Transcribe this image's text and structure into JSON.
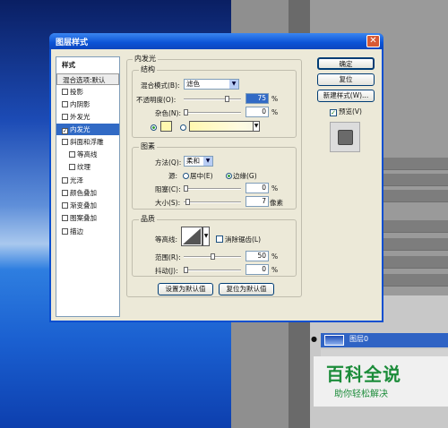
{
  "dialog": {
    "title": "图层样式",
    "close": "✕"
  },
  "style_list": {
    "header": "样式",
    "items": [
      {
        "label": "混合选项:默认",
        "checkbox": false,
        "header": true
      },
      {
        "label": "投影",
        "checkbox": true,
        "checked": false
      },
      {
        "label": "内阴影",
        "checkbox": true,
        "checked": false
      },
      {
        "label": "外发光",
        "checkbox": true,
        "checked": false
      },
      {
        "label": "内发光",
        "checkbox": true,
        "checked": true,
        "selected": true
      },
      {
        "label": "斜面和浮雕",
        "checkbox": true,
        "checked": false
      },
      {
        "label": "等高线",
        "checkbox": true,
        "checked": false,
        "indent": true
      },
      {
        "label": "纹理",
        "checkbox": true,
        "checked": false,
        "indent": true
      },
      {
        "label": "光泽",
        "checkbox": true,
        "checked": false
      },
      {
        "label": "颜色叠加",
        "checkbox": true,
        "checked": false
      },
      {
        "label": "渐变叠加",
        "checkbox": true,
        "checked": false
      },
      {
        "label": "图案叠加",
        "checkbox": true,
        "checked": false
      },
      {
        "label": "描边",
        "checkbox": true,
        "checked": false
      }
    ]
  },
  "inner_glow": {
    "section_title": "内发光",
    "structure": {
      "title": "结构",
      "blend_mode_label": "混合模式(B):",
      "blend_mode_value": "滤色",
      "opacity_label": "不透明度(O):",
      "opacity_value": "75",
      "noise_label": "杂色(N):",
      "noise_value": "0",
      "unit": "%"
    },
    "elements": {
      "title": "图素",
      "method_label": "方法(Q):",
      "method_value": "柔和",
      "source_label": "源:",
      "center_label": "居中(E)",
      "edge_label": "边缘(G)",
      "choke_label": "阻塞(C):",
      "choke_value": "0",
      "size_label": "大小(S):",
      "size_value": "7",
      "size_unit": "像素",
      "unit": "%"
    },
    "quality": {
      "title": "品质",
      "contour_label": "等高线:",
      "antialias_label": "消除锯齿(L)",
      "range_label": "范围(R):",
      "range_value": "50",
      "jitter_label": "抖动(J):",
      "jitter_value": "0",
      "unit": "%"
    },
    "buttons": {
      "make_default": "设置为默认值",
      "reset_default": "复位为默认值"
    }
  },
  "right_buttons": {
    "ok": "确定",
    "reset": "复位",
    "new_style": "新建样式(W)...",
    "preview": "预览(V)"
  },
  "layers_panel": {
    "layer_name": "图层0"
  },
  "watermark": {
    "title": "百科全说",
    "subtitle": "助你轻松解决"
  },
  "colors": {
    "dialog_bg": "#ece9d8",
    "title_bar": "#0b53d6",
    "selection": "#316ac5",
    "glow_color": "#fff8b0",
    "watermark_green": "#1c8c3a"
  }
}
